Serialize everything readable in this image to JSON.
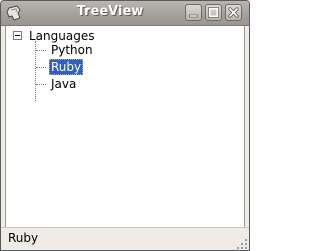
{
  "window": {
    "title": "TreeView"
  },
  "tree": {
    "root": {
      "label": "Languages",
      "expanded": true,
      "children": [
        {
          "label": "Python",
          "selected": false
        },
        {
          "label": "Ruby",
          "selected": true
        },
        {
          "label": "Java",
          "selected": false
        }
      ]
    }
  },
  "status": {
    "text": "Ruby"
  },
  "colors": {
    "selection": "#2f60c2",
    "titlebar": "#a8a4a0",
    "window_bg": "#efebe7"
  },
  "icons": {
    "app": "app-icon",
    "minimize": "minimize-icon",
    "maximize": "maximize-icon",
    "close": "close-icon",
    "expander": "collapse-toggle-icon",
    "grip": "resize-grip-icon"
  }
}
